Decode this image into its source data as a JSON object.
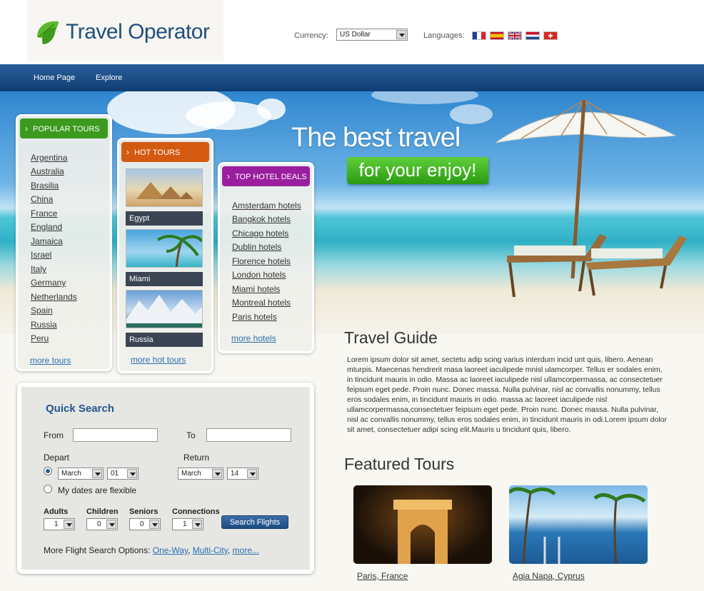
{
  "header": {
    "logo_text": "Travel Operator",
    "currency_label": "Currency:",
    "currency_value": "US Dollar",
    "languages_label": "Languages:",
    "flags": [
      "france-flag",
      "spain-flag",
      "uk-flag",
      "netherlands-flag",
      "switzerland-flag"
    ]
  },
  "nav": {
    "items": [
      "Home Page",
      "Explore"
    ]
  },
  "hero": {
    "title": "The best travel",
    "badge": "for your enjoy!"
  },
  "popular_tours": {
    "title": "POPULAR TOURS",
    "items": [
      "Argentina",
      "Australia",
      "Brasilia",
      "China",
      "France",
      "England",
      "Jamaica",
      "Israel",
      "Italy",
      "Germany",
      "Netherlands",
      "Spain",
      "Russia",
      "Peru"
    ],
    "more": "more tours",
    "color": "#3c9a1e"
  },
  "hot_tours": {
    "title": "HOT TOURS",
    "items": [
      "Egypt",
      "Miami",
      "Russia"
    ],
    "more": "more hot tours",
    "color": "#d45a12"
  },
  "hotel_deals": {
    "title": "TOP HOTEL DEALS",
    "items": [
      "Amsterdam hotels",
      "Bangkok hotels",
      "Chicago hotels",
      "Dublin hotels",
      "Florence hotels",
      "London hotels",
      "Miami hotels",
      "Montreal hotels",
      "Paris hotels"
    ],
    "more": "more hotels",
    "color": "#9a1f9e"
  },
  "guide": {
    "title": "Travel Guide",
    "text": "Lorem ipsum dolor sit amet, sectetu adip scing varius interdum incid unt quis, libero. Aenean mturpis. Maecenas hendrerit masa laoreet iaculipede mnisl ulamcorper. Tellus er sodales enim, in tincidunt mauris in odio. Massa ac laoreet iaculipede nisl ullamcorpermassa, ac consectetuer feipsum eget pede. Proin nunc. Donec massa. Nulla pulvinar, nisl ac convallis nonummy, tellus eros sodales enim, in tincidunt mauris in odio. massa ac laoreet iaculipede nisl ullamcorpermassa,consectetuer feipsum eget pede. Proin nunc. Donec massa. Nulla pulvinar, nisl ac convallis nonummy, tellus eros sodales enim, in tincidunt mauris in odi.Lorem ipsum dolor sit amet, consectetuer adipi scing elit.Mauris u tincidunt quis, libero."
  },
  "featured": {
    "title": "Featured Tours",
    "items": [
      "Paris, France",
      "Agia Napa, Cyprus"
    ]
  },
  "quick_search": {
    "title": "Quick Search",
    "from_label": "From",
    "to_label": "To",
    "depart_label": "Depart",
    "return_label": "Return",
    "depart_month": "March",
    "depart_day": "01",
    "return_month": "March",
    "return_day": "14",
    "flexible_label": "My dates are flexible",
    "adults_label": "Adults",
    "children_label": "Children",
    "seniors_label": "Seniors",
    "connections_label": "Connections",
    "adults_value": "1",
    "children_value": "0",
    "seniors_value": "0",
    "connections_value": "1",
    "search_button": "Search Flights",
    "more_options_label": "More Flight Search Options:",
    "one_way": "One-Way",
    "multi_city": "Multi-City",
    "more": "more..."
  }
}
